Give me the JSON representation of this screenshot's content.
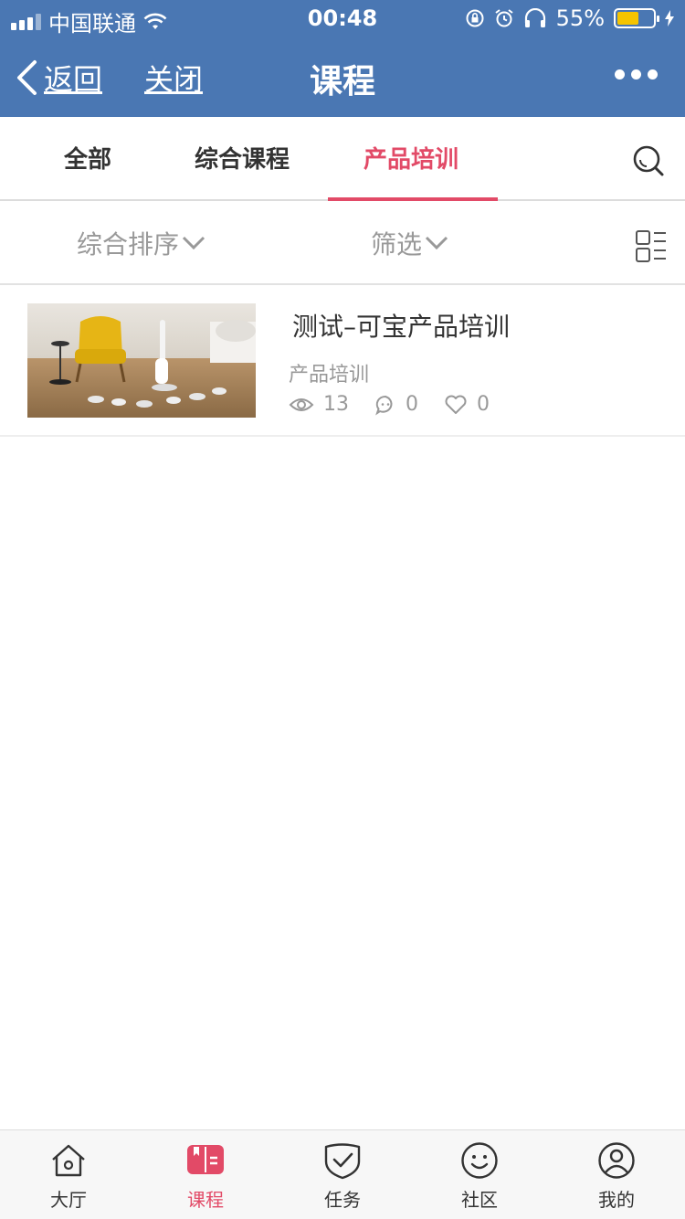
{
  "status_bar": {
    "carrier": "中国联通",
    "time": "00:48",
    "battery_pct": "55%",
    "battery_color": "#f5c400"
  },
  "nav": {
    "back_label": "返回",
    "close_label": "关闭",
    "title": "课程",
    "bar_color": "#4a77b3"
  },
  "tabs": [
    {
      "label": "全部",
      "active": false
    },
    {
      "label": "综合课程",
      "active": false
    },
    {
      "label": "产品培训",
      "active": true
    }
  ],
  "accent_color": "#e24a67",
  "filters": {
    "sort_label": "综合排序",
    "filter_label": "筛选"
  },
  "courses": [
    {
      "title": "测试–可宝产品培训",
      "category": "产品培训",
      "views": "13",
      "comments": "0",
      "likes": "0"
    }
  ],
  "bottom_nav": [
    {
      "label": "大厅",
      "icon": "home-icon",
      "active": false
    },
    {
      "label": "课程",
      "icon": "book-icon",
      "active": true
    },
    {
      "label": "任务",
      "icon": "task-check-icon",
      "active": false
    },
    {
      "label": "社区",
      "icon": "smile-icon",
      "active": false
    },
    {
      "label": "我的",
      "icon": "user-icon",
      "active": false
    }
  ]
}
